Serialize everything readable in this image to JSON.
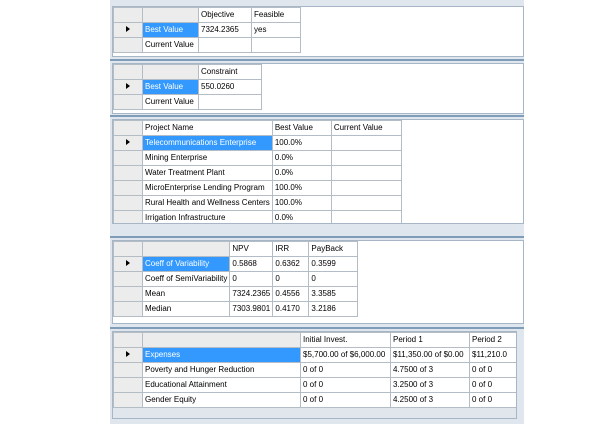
{
  "objective_grid": {
    "headers": [
      "Objective",
      "Feasible"
    ],
    "rows": [
      {
        "label": "Best Value",
        "values": [
          "7324.2365",
          "yes"
        ]
      },
      {
        "label": "Current Value",
        "values": [
          "",
          ""
        ]
      }
    ]
  },
  "constraint_grid": {
    "headers": [
      "Constraint"
    ],
    "rows": [
      {
        "label": "Best Value",
        "values": [
          "550.0260"
        ]
      },
      {
        "label": "Current Value",
        "values": [
          ""
        ]
      }
    ]
  },
  "project_grid": {
    "headers": [
      "Project Name",
      "Best Value",
      "Current Value"
    ],
    "rows": [
      {
        "values": [
          "Telecommunications Enterprise",
          "100.0%",
          ""
        ]
      },
      {
        "values": [
          "Mining Enterprise",
          "0.0%",
          ""
        ]
      },
      {
        "values": [
          "Water Treatment Plant",
          "0.0%",
          ""
        ]
      },
      {
        "values": [
          "MicroEnterprise Lending Program",
          "100.0%",
          ""
        ]
      },
      {
        "values": [
          "Rural Health and Wellness Centers",
          "100.0%",
          ""
        ]
      },
      {
        "values": [
          "Irrigation Infrastructure",
          "0.0%",
          ""
        ]
      }
    ]
  },
  "stats_grid": {
    "headers": [
      "NPV",
      "IRR",
      "PayBack"
    ],
    "rows": [
      {
        "label": "Coeff of Variability",
        "values": [
          "0.5868",
          "0.6362",
          "0.3599"
        ]
      },
      {
        "label": "Coeff of SemiVariability",
        "values": [
          "0",
          "0",
          "0"
        ]
      },
      {
        "label": "Mean",
        "values": [
          "7324.2365",
          "0.4556",
          "3.3585"
        ]
      },
      {
        "label": "Median",
        "values": [
          "7303.9801",
          "0.4170",
          "3.2186"
        ]
      }
    ]
  },
  "expense_grid": {
    "headers": [
      "Initial Invest.",
      "Period 1",
      "Period 2"
    ],
    "rows": [
      {
        "label": "Expenses",
        "values": [
          "$5,700.00 of $6,000.00",
          "$11,350.00 of $0.00",
          "$11,210.0"
        ]
      },
      {
        "label": "Poverty and Hunger Reduction",
        "values": [
          "0 of 0",
          "4.7500 of 3",
          "0 of 0"
        ]
      },
      {
        "label": "Educational Attainment",
        "values": [
          "0 of 0",
          "3.2500 of 3",
          "0 of 0"
        ]
      },
      {
        "label": "Gender Equity",
        "values": [
          "0 of 0",
          "4.2500 of 3",
          "0 of 0"
        ]
      }
    ]
  },
  "row_pointer_icon": "triangle-right-icon"
}
